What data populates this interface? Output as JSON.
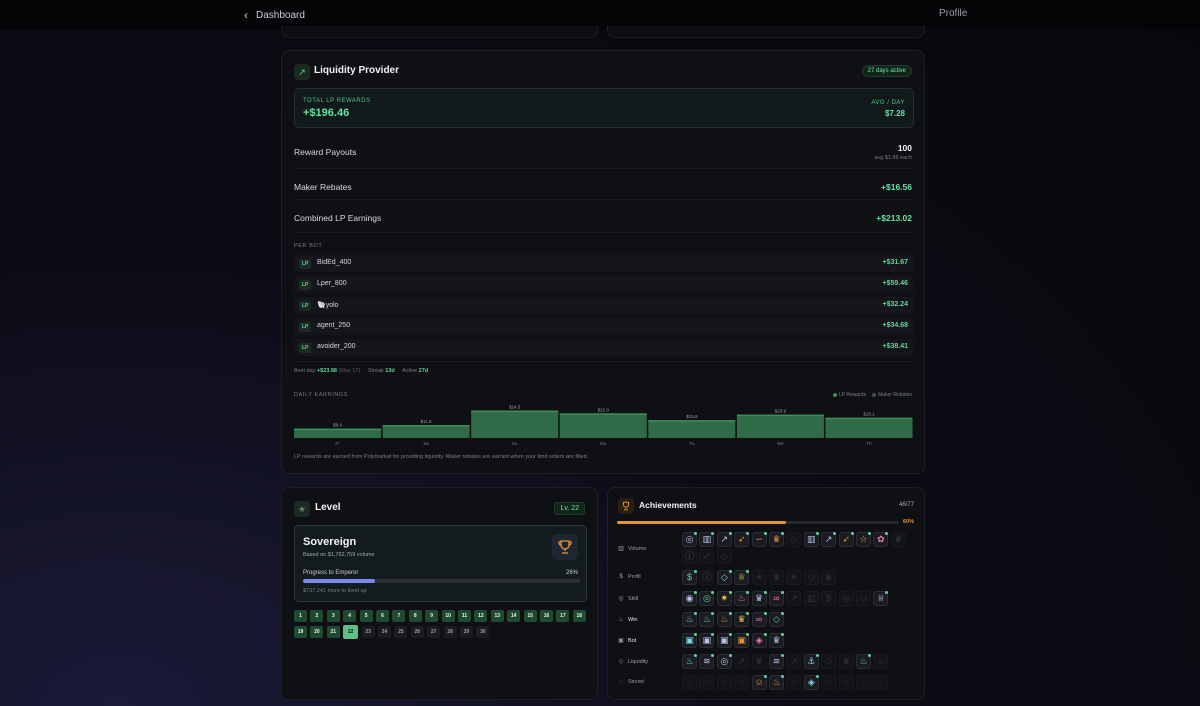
{
  "nav": {
    "back_label": "Dashboard",
    "profile_label": "Profile"
  },
  "lp": {
    "title": "Liquidity Provider",
    "days_active": "27 days active",
    "total_label": "TOTAL LP REWARDS",
    "total_value": "+$196.46",
    "avg_label": "AVG / DAY",
    "avg_value": "$7.28",
    "reward_payouts_label": "Reward Payouts",
    "reward_payouts_value": "100",
    "reward_payouts_sub": "avg $1.96 each",
    "maker_rebates_label": "Maker Rebates",
    "maker_rebates_value": "+$16.56",
    "combined_label": "Combined LP Earnings",
    "combined_value": "+$213.02",
    "per_bot_label": "PER BOT",
    "bot_tag": "LP",
    "bots": [
      {
        "name": "BidEd_400",
        "value": "+$31.67"
      },
      {
        "name": "Lper_800",
        "value": "+$59.46"
      },
      {
        "name": "🐚yolo",
        "value": "+$32.24"
      },
      {
        "name": "agent_250",
        "value": "+$34.68"
      },
      {
        "name": "avoider_200",
        "value": "+$38.41"
      }
    ],
    "best_day_label": "Best day",
    "best_day_value": "+$23.98",
    "best_day_date": "(May 17)",
    "streak_label": "Streak",
    "streak_value": "13d",
    "active_label": "Active",
    "active_value": "27d",
    "daily_label": "DAILY EARNINGS",
    "legend_lp": "LP Rewards",
    "legend_maker": "Maker Rebates",
    "footnote": "LP rewards are earned from Polymarket for providing liquidity. Maker rebates are earned when your limit orders are filled.",
    "colors": {
      "accent": "#5fd494",
      "bar": "#2f6b47"
    }
  },
  "chart_data": {
    "type": "bar",
    "categories": [
      "Fr",
      "Sa",
      "Su",
      "Mo",
      "Tu",
      "We",
      "Th"
    ],
    "values": [
      8.4,
      11.6,
      24.5,
      22.0,
      15.9,
      20.9,
      18.1
    ],
    "value_labels": [
      "$8.4",
      "$11.6",
      "$24.5",
      "$22.0",
      "$15.9",
      "$20.9",
      "$18.1"
    ],
    "title": "DAILY EARNINGS",
    "legend": [
      "LP Rewards",
      "Maker Rebates"
    ],
    "ylim": [
      0,
      25
    ]
  },
  "level": {
    "title": "Level",
    "badge": "Lv. 22",
    "tier_name": "Sovereign",
    "tier_sub": "Based on $1,762,759 volume",
    "progress_label": "Progress to Emperor",
    "progress_pct_label": "26%",
    "progress_fraction": 0.26,
    "progress_note": "$737,241 more to level up",
    "current_level": 22,
    "levels": [
      "1",
      "2",
      "3",
      "4",
      "5",
      "6",
      "7",
      "8",
      "9",
      "10",
      "11",
      "12",
      "13",
      "14",
      "15",
      "16",
      "17",
      "18",
      "19",
      "20",
      "21",
      "22",
      "23",
      "24",
      "25",
      "26",
      "27",
      "28",
      "29",
      "30"
    ]
  },
  "achievements": {
    "title": "Achievements",
    "count": "46/77",
    "pct_label": "60%",
    "progress_fraction": 0.6,
    "categories": [
      {
        "name": "Volume",
        "icon": "bar-chart-icon"
      },
      {
        "name": "Profit",
        "icon": "dollar-icon"
      },
      {
        "name": "Skill",
        "icon": "target-icon"
      },
      {
        "name": "Win",
        "icon": "flame-icon"
      },
      {
        "name": "Bot",
        "icon": "robot-icon"
      },
      {
        "name": "Liquidity",
        "icon": "droplet-icon"
      },
      {
        "name": "Secret",
        "icon": "lock-icon"
      }
    ]
  }
}
